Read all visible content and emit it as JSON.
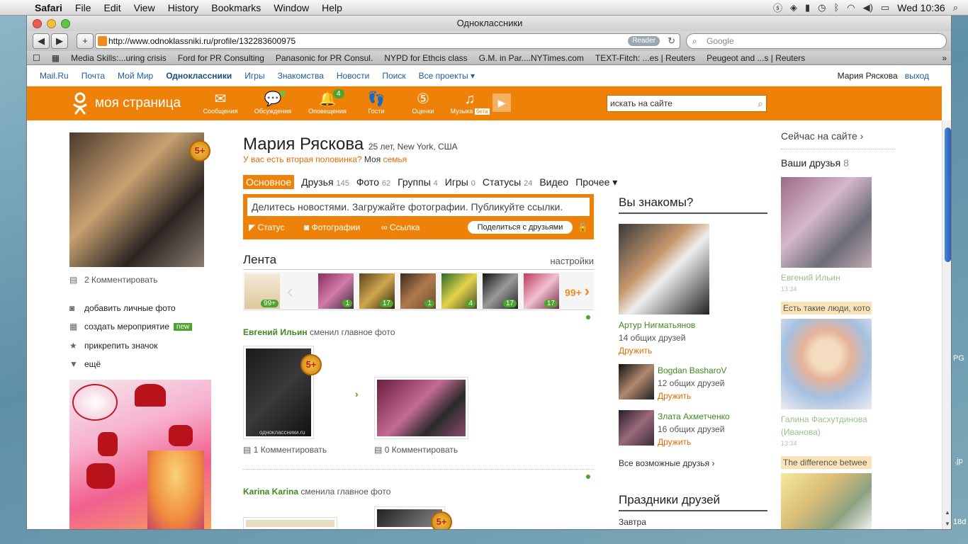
{
  "menubar": {
    "app": "Safari",
    "items": [
      "File",
      "Edit",
      "View",
      "History",
      "Bookmarks",
      "Window",
      "Help"
    ],
    "clock": "Wed 10:36"
  },
  "window": {
    "title": "Одноклассники"
  },
  "browser": {
    "url": "http://www.odnoklassniki.ru/profile/132283600975",
    "reader": "Reader",
    "search_placeholder": "Google"
  },
  "bookmarks": [
    "Media Skills:...uring crisis",
    "Ford for PR Consulting",
    "Panasonic for PR Consul.",
    "NYPD for Ethcis class",
    "G.M. in Par....NYTimes.com",
    "TEXT-Fitch: ...es | Reuters",
    "Peugeot and ...s | Reuters"
  ],
  "portal": {
    "links": [
      "Mail.Ru",
      "Почта",
      "Мой Мир",
      "Одноклассники",
      "Игры",
      "Знакомства",
      "Новости",
      "Поиск",
      "Все проекты ▾"
    ],
    "user": "Мария Ряскова",
    "logout": "выход"
  },
  "header": {
    "logo": "моя страница",
    "tools": [
      {
        "icon": "envelope-icon",
        "label": "Сообщения",
        "glyph": "✉",
        "badge": ""
      },
      {
        "icon": "chat-icon",
        "label": "Обсуждения",
        "glyph": "💬",
        "badge": ""
      },
      {
        "icon": "bell-icon",
        "label": "Оповещения",
        "glyph": "🔔",
        "badge": "4"
      },
      {
        "icon": "footprints-icon",
        "label": "Гости",
        "glyph": "👣",
        "badge": ""
      },
      {
        "icon": "rating-icon",
        "label": "Оценки",
        "glyph": "⑤",
        "badge": ""
      },
      {
        "icon": "music-icon",
        "label": "Музыка",
        "glyph": "♫",
        "badge": ""
      }
    ],
    "music_beta": "бета",
    "search_placeholder": "искать на сайте"
  },
  "profile": {
    "name": "Мария Ряскова",
    "meta": "25 лет, New York, США",
    "half_q": "У вас есть вторая половинка?",
    "family_pre": "Моя",
    "family_link": "семья",
    "badge": "5+",
    "comments": "2 Комментировать"
  },
  "left_actions": [
    {
      "icon": "camera-icon",
      "label": "добавить личные фото"
    },
    {
      "icon": "calendar-icon",
      "label": "создать мероприятие",
      "badge": "new"
    },
    {
      "icon": "star-icon",
      "label": "прикрепить значок"
    },
    {
      "icon": "triangle-down-icon",
      "label": "ещё"
    }
  ],
  "tabs": [
    {
      "label": "Основное",
      "count": ""
    },
    {
      "label": "Друзья",
      "count": "145"
    },
    {
      "label": "Фото",
      "count": "62"
    },
    {
      "label": "Группы",
      "count": "4"
    },
    {
      "label": "Игры",
      "count": "0"
    },
    {
      "label": "Статусы",
      "count": "24"
    },
    {
      "label": "Видео",
      "count": ""
    },
    {
      "label": "Прочее ▾",
      "count": ""
    }
  ],
  "share": {
    "placeholder": "Делитесь новостями. Загружайте фотографии. Публикуйте ссылки.",
    "status": "Статус",
    "photos": "Фотографии",
    "link": "Ссылка",
    "button": "Поделиться с друзьями"
  },
  "feed": {
    "title": "Лента",
    "settings": "настройки",
    "strip_total": "99+",
    "strip_more": "99+",
    "strip_counts": [
      "1",
      "17",
      "1",
      "4",
      "17",
      "17"
    ],
    "stories": [
      {
        "name": "Евгений Ильин",
        "action": "сменил главное фото",
        "c1": "1 Комментировать",
        "c2": "0 Комментировать",
        "watermark": "одноклассники.ru"
      },
      {
        "name": "Karina Karina",
        "action": "сменила главное фото"
      }
    ]
  },
  "know": {
    "title": "Вы знакомы?",
    "people": [
      {
        "name": "Артур Нигматьянов",
        "mutual": "14 общих друзей",
        "add": "Дружить"
      },
      {
        "name": "Bogdan BasharoV",
        "mutual": "12 общих друзей",
        "add": "Дружить"
      },
      {
        "name": "Злата Ахметченко",
        "mutual": "16 общих друзей",
        "add": "Дружить"
      }
    ],
    "all": "Все возможные друзья ›"
  },
  "holidays": {
    "title": "Праздники друзей",
    "tomorrow": "Завтра"
  },
  "side": {
    "online": "Сейчас на сайте ›",
    "friends": "Ваши друзья",
    "friends_count": "8",
    "p1": "Евгений Ильин",
    "t1": "13:34",
    "note1": "Есть такие люди, кото",
    "p2a": "Галина Фасхутдинова",
    "p2b": "(Иванова)",
    "t2": "13:34",
    "note2": "The difference betwee"
  },
  "desktop": {
    "l1": "PG",
    "l2": ".jp",
    "l3": "18d"
  }
}
